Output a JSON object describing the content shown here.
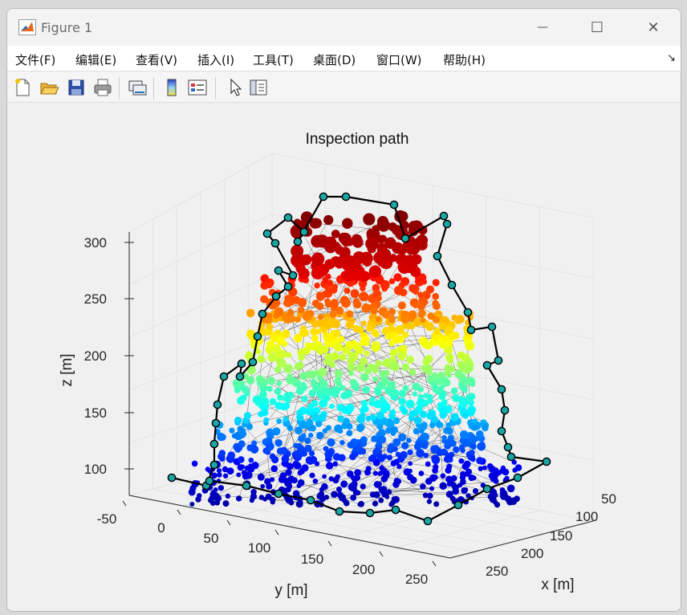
{
  "window": {
    "title": "Figure 1",
    "minimize_glyph": "—",
    "maximize_glyph": "☐",
    "close_glyph": "✕"
  },
  "menu": {
    "items": [
      "文件(F)",
      "编辑(E)",
      "查看(V)",
      "插入(I)",
      "工具(T)",
      "桌面(D)",
      "窗口(W)",
      "帮助(H)"
    ],
    "overflow_glyph": "↘"
  },
  "toolbar": {
    "icons": [
      "new-figure-icon",
      "open-file-icon",
      "save-icon",
      "print-icon",
      "link-plot-icon",
      "colorbar-icon",
      "legend-icon",
      "pointer-icon",
      "property-inspector-icon"
    ]
  },
  "figure": {
    "title": "Inspection path",
    "xlabel": "x [m]",
    "ylabel": "y [m]",
    "zlabel": "z [m]",
    "x_ticks": [
      "50",
      "100",
      "150",
      "200",
      "250"
    ],
    "y_ticks": [
      "-50",
      "0",
      "50",
      "100",
      "150",
      "200",
      "250"
    ],
    "z_ticks": [
      "100",
      "150",
      "200",
      "250",
      "300"
    ]
  },
  "chart_data": {
    "type": "scatter",
    "view": "3d",
    "title": "Inspection path",
    "xlabel": "x [m]",
    "ylabel": "y [m]",
    "zlabel": "z [m]",
    "xlim": [
      30,
      280
    ],
    "ylim": [
      -60,
      280
    ],
    "zlim": [
      80,
      310
    ],
    "grid": true,
    "colormap": "jet (by z)",
    "series": [
      {
        "marker": "cyan-filled circle, black edge",
        "line": "black"
      },
      {
        "marker": "small colored points by height",
        "line": "thin black mesh"
      }
    ],
    "colors": {
      "path_line": "#000000",
      "waypoint_fill": "#1aa6a6",
      "low_z": "#0a0a8c",
      "high_z": "#b00000"
    }
  }
}
